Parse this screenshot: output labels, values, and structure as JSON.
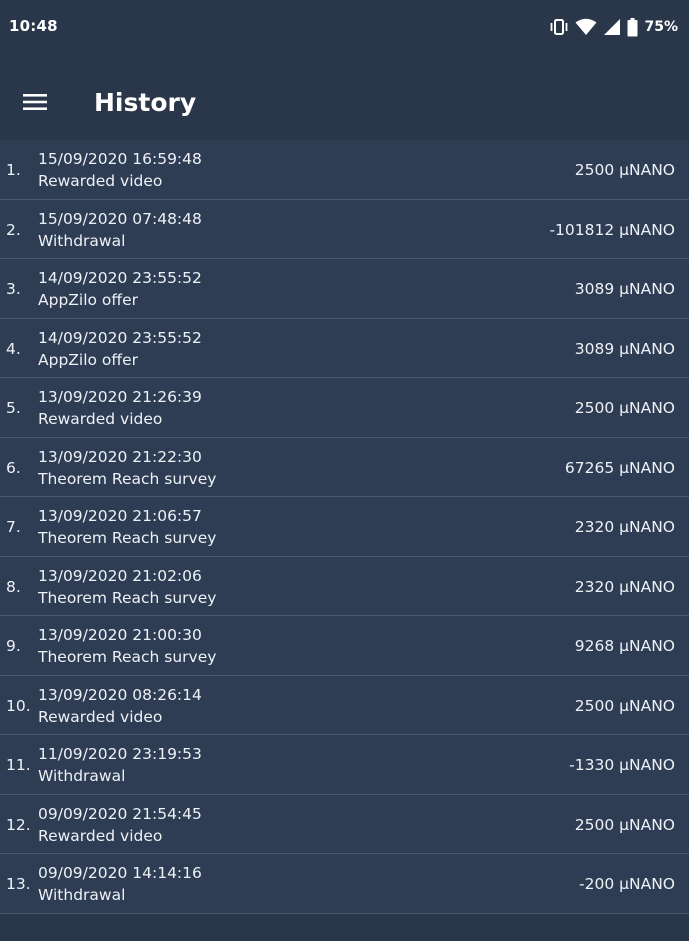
{
  "status_bar": {
    "time": "10:48",
    "battery": "75%",
    "icons": [
      "vibrate-icon",
      "wifi-icon",
      "cell-signal-icon",
      "battery-icon"
    ]
  },
  "app_bar": {
    "menu_icon": "hamburger-menu-icon",
    "title": "History"
  },
  "colors": {
    "background": "#2a3649",
    "row_background": "#2e3d54",
    "divider": "#4a586d",
    "text": "#eef1f5"
  },
  "transactions": [
    {
      "index": "1.",
      "datetime": "15/09/2020 16:59:48",
      "description": "Rewarded video",
      "amount": "2500 µNANO"
    },
    {
      "index": "2.",
      "datetime": "15/09/2020 07:48:48",
      "description": "Withdrawal",
      "amount": "-101812 µNANO"
    },
    {
      "index": "3.",
      "datetime": "14/09/2020 23:55:52",
      "description": "AppZilo offer",
      "amount": "3089 µNANO"
    },
    {
      "index": "4.",
      "datetime": "14/09/2020 23:55:52",
      "description": "AppZilo offer",
      "amount": "3089 µNANO"
    },
    {
      "index": "5.",
      "datetime": "13/09/2020 21:26:39",
      "description": "Rewarded video",
      "amount": "2500 µNANO"
    },
    {
      "index": "6.",
      "datetime": "13/09/2020 21:22:30",
      "description": "Theorem Reach survey",
      "amount": "67265 µNANO"
    },
    {
      "index": "7.",
      "datetime": "13/09/2020 21:06:57",
      "description": "Theorem Reach survey",
      "amount": "2320 µNANO"
    },
    {
      "index": "8.",
      "datetime": "13/09/2020 21:02:06",
      "description": "Theorem Reach survey",
      "amount": "2320 µNANO"
    },
    {
      "index": "9.",
      "datetime": "13/09/2020 21:00:30",
      "description": "Theorem Reach survey",
      "amount": "9268 µNANO"
    },
    {
      "index": "10.",
      "datetime": "13/09/2020 08:26:14",
      "description": "Rewarded video",
      "amount": "2500 µNANO"
    },
    {
      "index": "11.",
      "datetime": "11/09/2020 23:19:53",
      "description": "Withdrawal",
      "amount": "-1330 µNANO"
    },
    {
      "index": "12.",
      "datetime": "09/09/2020 21:54:45",
      "description": "Rewarded video",
      "amount": "2500 µNANO"
    },
    {
      "index": "13.",
      "datetime": "09/09/2020 14:14:16",
      "description": "Withdrawal",
      "amount": "-200 µNANO"
    }
  ]
}
